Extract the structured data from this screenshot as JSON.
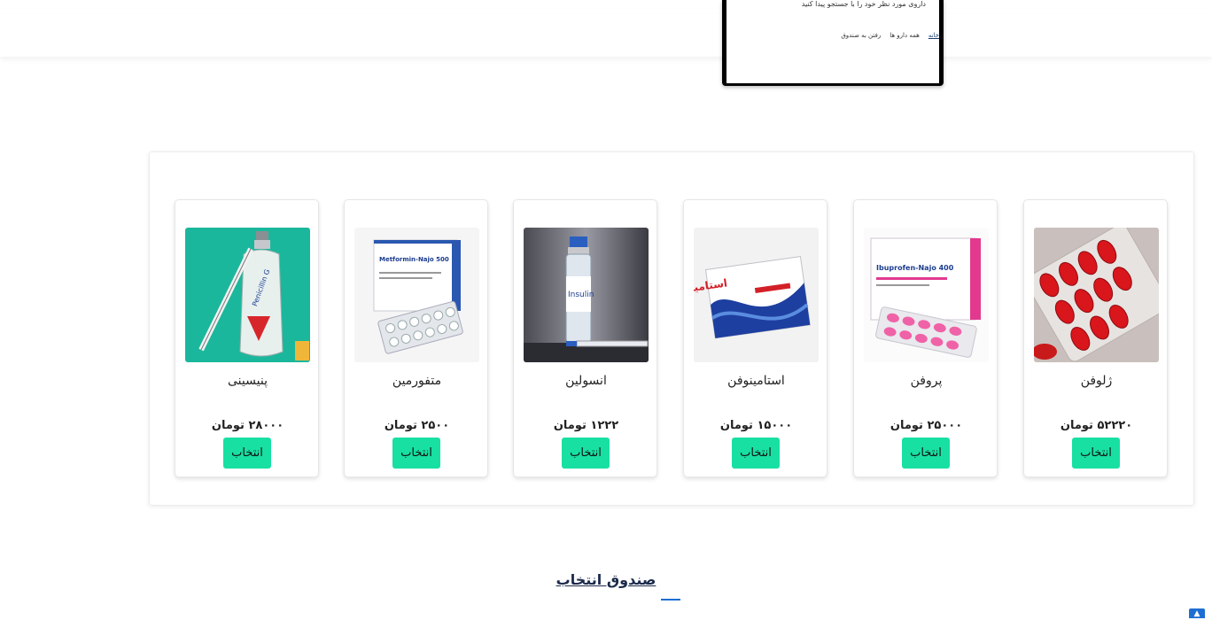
{
  "phone_preview": {
    "caption": "داروی مورد نظر خود را با جستجو پیدا کنید"
  },
  "nav": {
    "items": [
      {
        "label": "خانه",
        "active": true
      },
      {
        "label": "همه دارو ها",
        "active": false
      },
      {
        "label": "رفتن به صندوق",
        "active": false
      }
    ]
  },
  "products": [
    {
      "name": "ژلوفن",
      "price": "۵۲۲۲۰ تومان",
      "button": "انتخاب",
      "image_icon": "red-softgel-blister-icon"
    },
    {
      "name": "پروفن",
      "price": "۲۵۰۰۰ تومان",
      "button": "انتخاب",
      "image_icon": "pink-tablet-box-icon"
    },
    {
      "name": "استامینوفن",
      "price": "۱۵۰۰۰ تومان",
      "button": "انتخاب",
      "image_icon": "blue-medicine-box-icon"
    },
    {
      "name": "انسولین",
      "price": "۱۲۲۲ تومان",
      "button": "انتخاب",
      "image_icon": "insulin-vial-syringe-icon"
    },
    {
      "name": "متفورمین",
      "price": "۲۵۰۰ تومان",
      "button": "انتخاب",
      "image_icon": "white-tablet-box-icon"
    },
    {
      "name": "پنیسینی",
      "price": "۲۸۰۰۰ تومان",
      "button": "انتخاب",
      "image_icon": "penicillin-bottle-syringe-icon"
    }
  ],
  "image_labels": {
    "ibuprofen_box": "Ibuprofen-Najo 400",
    "acetaminophen_box": "استامین ۵۰۰",
    "insulin_vial": "Insulin",
    "metformin_box": "Metformin-Najo 500",
    "penicillin_bottle": "Penicillin G"
  },
  "section": {
    "title": "صندوق انتخاب"
  },
  "colors": {
    "button": "#18e0a2",
    "accent": "#1d6fd1",
    "nav_active": "#1a3d6e"
  }
}
